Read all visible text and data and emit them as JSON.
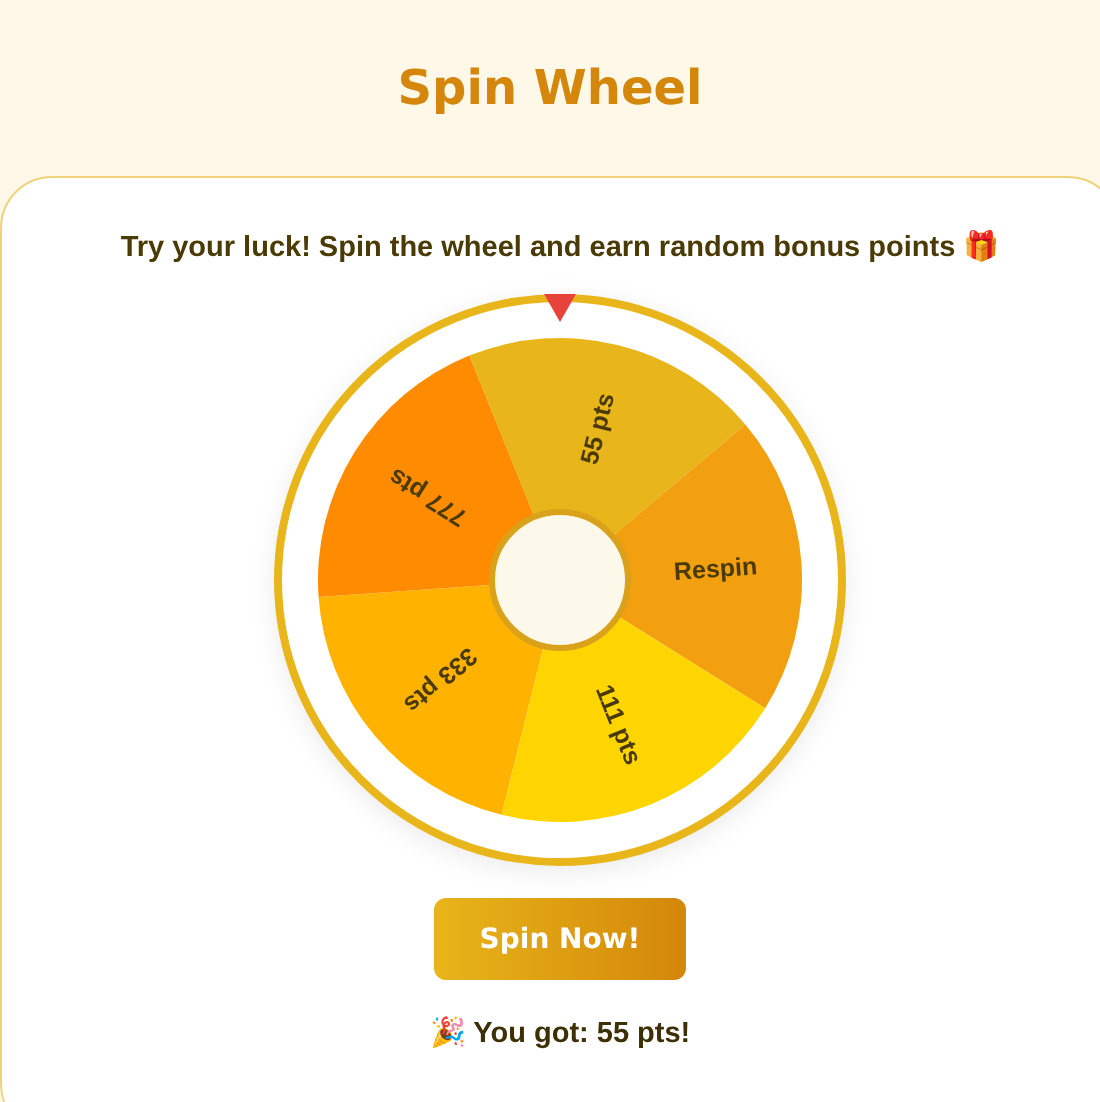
{
  "title": "Spin Wheel",
  "subtitle": "Try your luck! Spin the wheel and earn random bonus points 🎁",
  "wheel": {
    "segments": [
      {
        "label": "55 pts",
        "color": "#e8b51a"
      },
      {
        "label": "Respin",
        "color": "#f2a010"
      },
      {
        "label": "111 pts",
        "color": "#ffd500"
      },
      {
        "label": "333 pts",
        "color": "#ffb300"
      },
      {
        "label": "777 pts",
        "color": "#ff8c00"
      }
    ]
  },
  "button": "Spin Now!",
  "result": "🎉 You got: 55 pts!"
}
